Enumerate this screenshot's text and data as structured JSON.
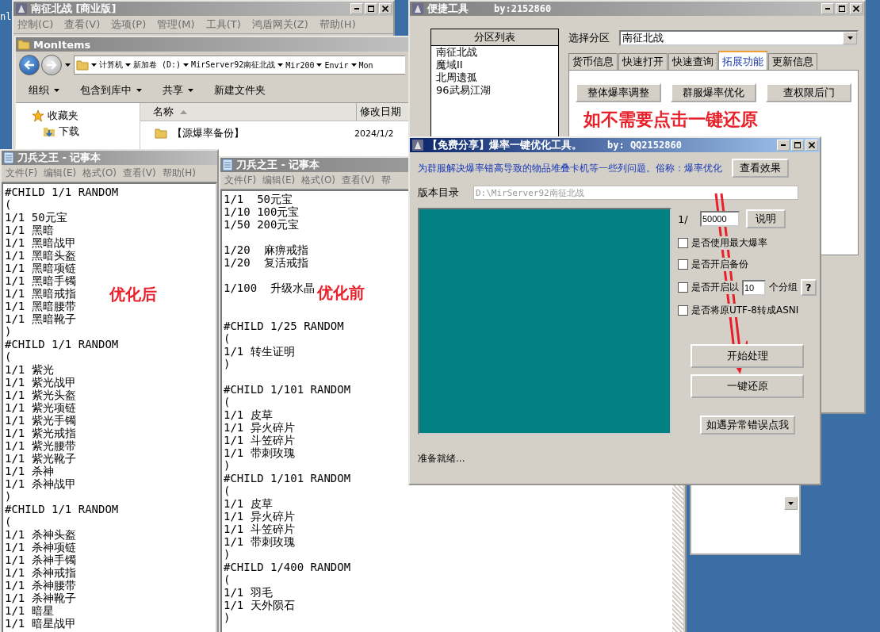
{
  "desktop": {
    "edge_text": "nl"
  },
  "server_window": {
    "title": "南征北战 [商业版]",
    "menu": [
      "控制(C)",
      "查看(V)",
      "选项(P)",
      "管理(M)",
      "工具(T)",
      "鸿盾网关(Z)",
      "帮助(H)"
    ]
  },
  "explorer": {
    "title": "MonItems",
    "path": [
      "计算机",
      "新加卷 (D:)",
      "MirServer92南征北战",
      "Mir200",
      "Envir",
      "Mon"
    ],
    "toolbar": [
      {
        "label": "组织",
        "has_menu": true
      },
      {
        "label": "包含到库中",
        "has_menu": true
      },
      {
        "label": "共享",
        "has_menu": true
      },
      {
        "label": "新建文件夹",
        "has_menu": false
      }
    ],
    "nav": [
      {
        "label": "收藏夹",
        "kind": "star"
      },
      {
        "label": "下载",
        "kind": "download"
      }
    ],
    "columns": [
      "名称",
      "修改日期"
    ],
    "rows": [
      {
        "name": "【源爆率备份】",
        "date": "2024/1/2"
      }
    ]
  },
  "notepad_left": {
    "title": "刀兵之王 - 记事本",
    "menu": [
      "文件(F)",
      "编辑(E)",
      "格式(O)",
      "查看(V)",
      "帮助(H)"
    ],
    "lines": [
      {
        "text": "#CHILD 1/1 RANDOM"
      },
      {
        "text": "("
      },
      {
        "text": "1/1 50元宝"
      },
      {
        "text": "1/1 黑暗"
      },
      {
        "text": "1/1 黑暗战甲"
      },
      {
        "text": "1/1 黑暗头盔"
      },
      {
        "text": "1/1 黑暗项链"
      },
      {
        "text": "1/1 黑暗手镯"
      },
      {
        "text": "1/1 黑暗戒指"
      },
      {
        "text": "1/1 黑暗腰带"
      },
      {
        "text": "1/1 黑暗靴子"
      },
      {
        "text": ")"
      },
      {
        "text": "#CHILD 1/1 RANDOM"
      },
      {
        "text": "("
      },
      {
        "text": "1/1 紫光"
      },
      {
        "text": "1/1 紫光战甲"
      },
      {
        "text": "1/1 紫光头盔"
      },
      {
        "text": "1/1 紫光项链"
      },
      {
        "text": "1/1 紫光手镯"
      },
      {
        "text": "1/1 紫光戒指"
      },
      {
        "text": "1/1 紫光腰带"
      },
      {
        "text": "1/1 紫光靴子"
      },
      {
        "text": "1/1 杀神"
      },
      {
        "text": "1/1 杀神战甲"
      },
      {
        "text": ")"
      },
      {
        "text": "#CHILD 1/1 RANDOM"
      },
      {
        "text": "("
      },
      {
        "text": "1/1 杀神头盔"
      },
      {
        "text": "1/1 杀神项链"
      },
      {
        "text": "1/1 杀神手镯"
      },
      {
        "text": "1/1 杀神戒指"
      },
      {
        "text": "1/1 杀神腰带"
      },
      {
        "text": "1/1 杀神靴子"
      },
      {
        "text": "1/1 暗星"
      },
      {
        "text": "1/1 暗星战甲"
      }
    ]
  },
  "notepad_right": {
    "title": "刀兵之王 - 记事本",
    "menu": [
      "文件(F)",
      "编辑(E)",
      "格式(O)",
      "查看(V)",
      "帮"
    ],
    "blocks": [
      {
        "wide_gap": false,
        "lines": [
          {
            "text": "1/1  50元宝"
          },
          {
            "text": "1/10 100元宝"
          },
          {
            "text": "1/50 200元宝"
          }
        ]
      },
      {
        "wide_gap": false,
        "lines": [
          {
            "text": "1/20  麻痹戒指"
          },
          {
            "text": "1/20  复活戒指"
          }
        ]
      },
      {
        "wide_gap": false,
        "lines": [
          {
            "text": "1/100  升级水晶"
          }
        ]
      },
      {
        "wide_gap": true,
        "lines": [
          {
            "text": "#CHILD 1/25 RANDOM"
          },
          {
            "text": "("
          },
          {
            "text": "1/1 转生证明"
          },
          {
            "text": ")"
          }
        ]
      },
      {
        "wide_gap": false,
        "lines": [
          {
            "text": "#CHILD 1/101 RANDOM"
          },
          {
            "text": "("
          },
          {
            "text": "1/1 皮草"
          },
          {
            "text": "1/1 异火碎片"
          },
          {
            "text": "1/1 斗笠碎片"
          },
          {
            "text": "1/1 带刺玫瑰"
          },
          {
            "text": ")"
          },
          {
            "text": "#CHILD 1/101 RANDOM"
          },
          {
            "text": "("
          },
          {
            "text": "1/1 皮草"
          },
          {
            "text": "1/1 异火碎片"
          },
          {
            "text": "1/1 斗笠碎片"
          },
          {
            "text": "1/1 带刺玫瑰"
          },
          {
            "text": ")"
          },
          {
            "text": "#CHILD 1/400 RANDOM"
          },
          {
            "text": "("
          },
          {
            "text": "1/1 羽毛"
          },
          {
            "text": "1/1 天外陨石"
          },
          {
            "text": ")"
          }
        ]
      }
    ]
  },
  "quick_tool": {
    "title": "便捷工具",
    "author": "by:2152860",
    "list_header": "分区列表",
    "partitions": [
      "南征北战",
      "魔域II",
      "北周遗孤",
      "96武易江湖"
    ],
    "select_label": "选择分区",
    "select_value": "南征北战",
    "tabs": [
      {
        "label": "货币信息",
        "selected": false
      },
      {
        "label": "快速打开",
        "selected": false
      },
      {
        "label": "快速查询",
        "selected": false
      },
      {
        "label": "拓展功能",
        "selected": true
      },
      {
        "label": "更新信息",
        "selected": false
      }
    ],
    "buttons": [
      "整体爆率调整",
      "群服爆率优化",
      "查权限后门"
    ]
  },
  "optimizer": {
    "title": "【免费分享】爆率一键优化工具。",
    "author": "by: QQ2152860",
    "description": "为群服解决爆率错高导致的物品堆叠卡机等一些列问题。俗称：爆率优化",
    "effect_button": "查看效果",
    "dir_label": "版本目录",
    "dir_value": "D:\\MirServer92南征北战",
    "dir_disabled": true,
    "rate_prefix": "1/",
    "rate_value": "50000",
    "help_button": "说明",
    "options": [
      {
        "label": "是否使用最大爆率",
        "checked": false,
        "kind": "plain"
      },
      {
        "label": "是否开启备份",
        "checked": false,
        "kind": "plain"
      },
      {
        "label": "是否开启以",
        "checked": false,
        "kind": "group",
        "value": "10",
        "suffix": "个分组",
        "help": "?"
      },
      {
        "label": "是否将原UTF-8转成ASNI",
        "checked": false,
        "kind": "plain"
      }
    ],
    "actions": [
      "开始处理",
      "一键还原"
    ],
    "error_button": "如遇异常错误点我",
    "status": "准备就绪..."
  },
  "annotations": [
    {
      "text": "如不需要点击一键还原",
      "kind": "tip"
    },
    {
      "text": "优化后",
      "kind": "after"
    },
    {
      "text": "优化前",
      "kind": "before"
    }
  ]
}
